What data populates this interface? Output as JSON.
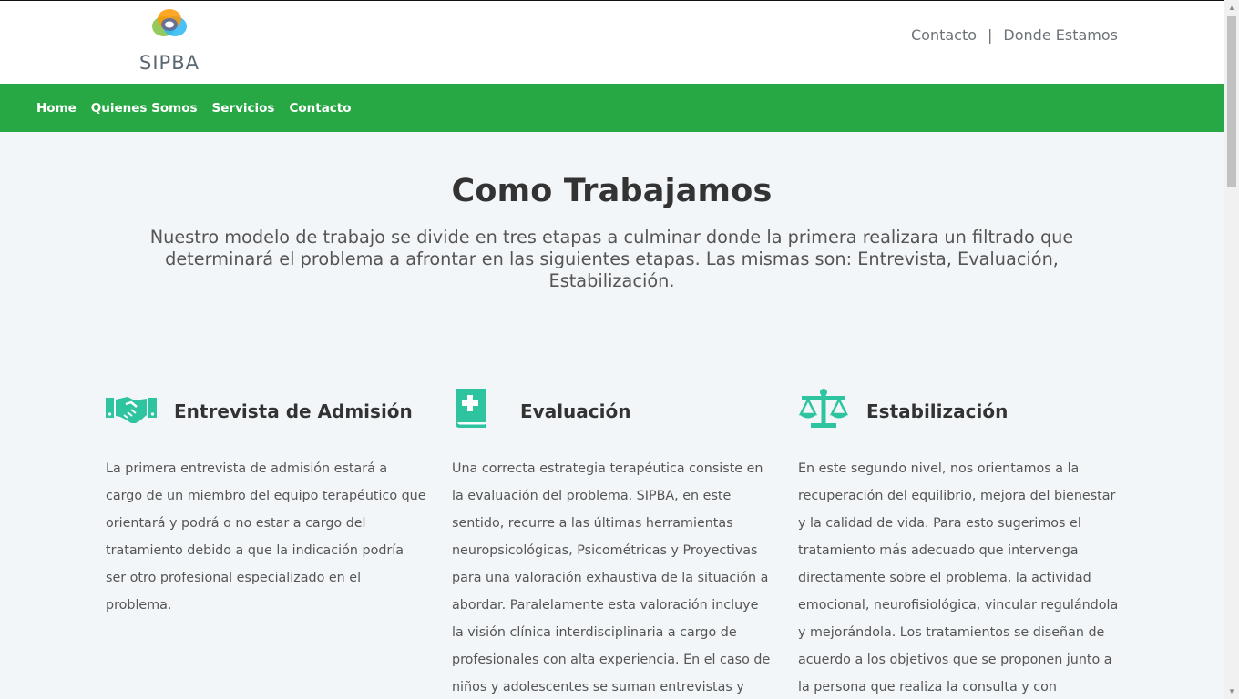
{
  "brand": {
    "name": "SIPBA",
    "logo_icon": "sipba-logo-icon"
  },
  "toplinks": {
    "contact": "Contacto",
    "separator": "|",
    "location": "Donde Estamos"
  },
  "nav": {
    "items": [
      {
        "label": "Home"
      },
      {
        "label": "Quienes Somos"
      },
      {
        "label": "Servicios"
      },
      {
        "label": "Contacto"
      }
    ]
  },
  "hero": {
    "title": "Como Trabajamos",
    "subtitle": "Nuestro modelo de trabajo se divide en tres etapas a culminar donde la primera realizara un filtrado que determinará el problema a afrontar en las siguientes etapas. Las mismas son: Entrevista, Evaluación, Estabilización."
  },
  "columns": [
    {
      "icon": "handshake-icon",
      "title": "Entrevista de Admisión",
      "body": "La primera entrevista de admisión estará a cargo de un miembro del equipo terapéutico que orientará y podrá o no estar a cargo del tratamiento debido a que la indicación podría ser otro profesional especializado en el problema."
    },
    {
      "icon": "medical-book-icon",
      "title": "Evaluación",
      "body": "Una correcta estrategia terapéutica consiste en la evaluación del problema. SIPBA, en este sentido, recurre a las últimas herramientas neuropsicológicas, Psicométricas y Proyectivas para una valoración exhaustiva de la situación a abordar. Paralelamente esta valoración incluye la visión clínica interdisciplinaria a cargo de profesionales con alta experiencia. En el caso de niños y adolescentes se suman entrevistas y"
    },
    {
      "icon": "balance-scale-icon",
      "title": "Estabilización",
      "body": "En este segundo nivel, nos orientamos a la recuperación del equilibrio, mejora del bienestar y la calidad de vida. Para esto sugerimos el tratamiento más adecuado que intervenga directamente sobre el problema, la actividad emocional, neurofisiológica, vincular regulándola y mejorándola. Los tratamientos se diseñan de acuerdo a los objetivos que se proponen junto a la persona que realiza la consulta y con"
    }
  ],
  "colors": {
    "accent": "#28a745",
    "icon": "#2ec4a0",
    "background": "#f3f6f8"
  }
}
